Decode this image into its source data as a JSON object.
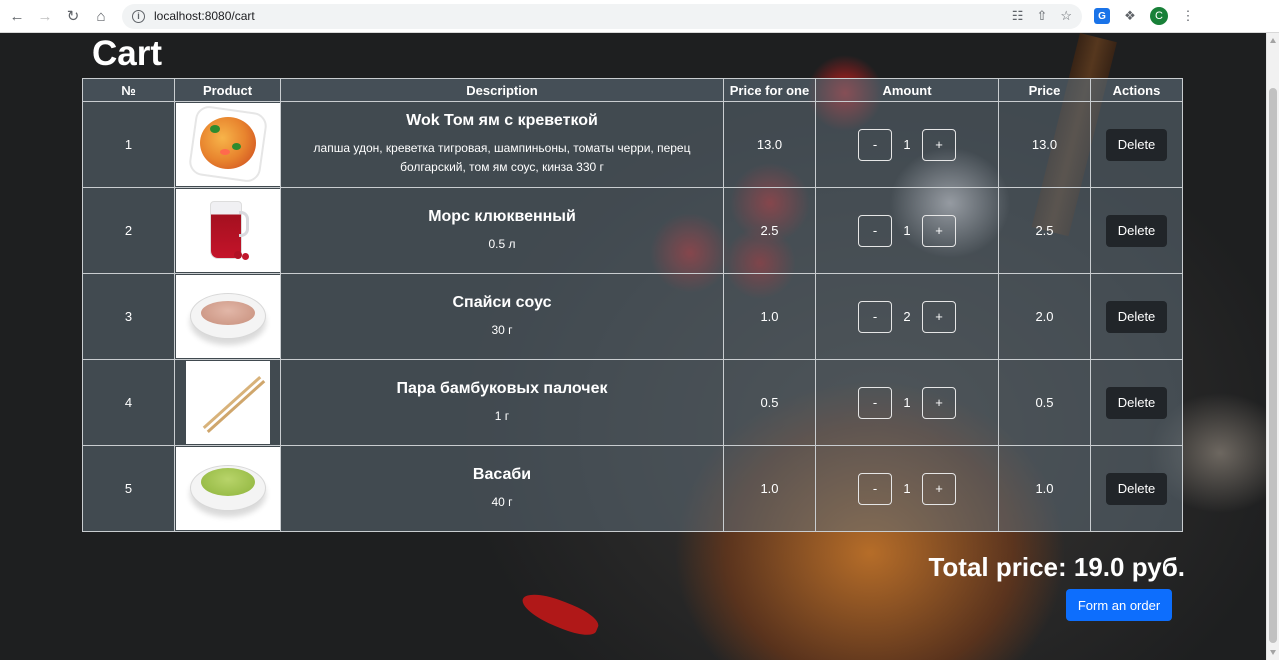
{
  "browser": {
    "url": "localhost:8080/cart",
    "avatar_letter": "C"
  },
  "page": {
    "heading": "Cart"
  },
  "table": {
    "headers": [
      "№",
      "Product",
      "Description",
      "Price for one",
      "Amount",
      "Price",
      "Actions"
    ],
    "rows": [
      {
        "num": "1",
        "name": "Wok Том ям с креветкой",
        "description": "лапша удон, креветка тигровая, шампиньоны, томаты черри, перец болгарский, том ям соус, кинза 330 г",
        "price_one": "13.0",
        "amount": "1",
        "price": "13.0",
        "image_icon": "wok-noodles-image"
      },
      {
        "num": "2",
        "name": "Морс клюквенный",
        "description": "0.5 л",
        "price_one": "2.5",
        "amount": "1",
        "price": "2.5",
        "image_icon": "cranberry-juice-jug-image"
      },
      {
        "num": "3",
        "name": "Спайси соус",
        "description": "30 г",
        "price_one": "1.0",
        "amount": "2",
        "price": "2.0",
        "image_icon": "spicy-sauce-bowl-image"
      },
      {
        "num": "4",
        "name": "Пара бамбуковых палочек",
        "description": "1 г",
        "price_one": "0.5",
        "amount": "1",
        "price": "0.5",
        "image_icon": "bamboo-chopsticks-image"
      },
      {
        "num": "5",
        "name": "Васаби",
        "description": "40 г",
        "price_one": "1.0",
        "amount": "1",
        "price": "1.0",
        "image_icon": "wasabi-bowl-image"
      }
    ],
    "minus_label": "-",
    "plus_label": "+",
    "delete_label": "Delete"
  },
  "summary": {
    "total_text": "Total price: 19.0 руб.",
    "order_button": "Form an order"
  },
  "colors": {
    "order_button": "#0d6efd",
    "delete_button": "#212529",
    "table_overlay": "#5e6e79"
  }
}
